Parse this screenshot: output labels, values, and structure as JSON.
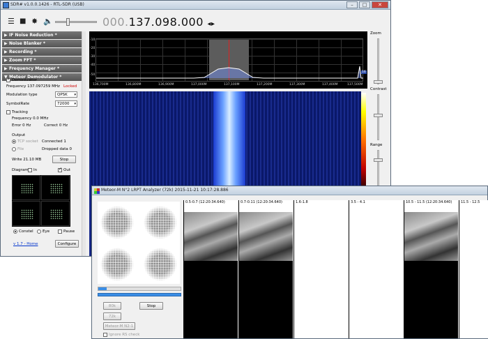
{
  "sdr": {
    "title": "SDR# v1.0.0.1426 - RTL-SDR (USB)",
    "frequency_dim": "000.",
    "frequency_main": "137.098.000",
    "freq_arrows": "◂▸",
    "panel": {
      "sections": [
        "IF Noise Reduction *",
        "Noise Blanker *",
        "Recording *",
        "Zoom FFT *",
        "Frequency Manager *",
        "Meteor Demodulator *"
      ],
      "demodulator_label": "Demodulator",
      "frequency_text": "Frequency 137.097259 MHz",
      "locked_text": "Locked",
      "modulation_label": "Modulation type",
      "modulation_value": "QPSK",
      "symbolrate_label": "SymbolRate",
      "symbolrate_value": "72000",
      "tracking_label": "Tracking",
      "freq_offset": "Frequency 0.0 MHz",
      "error_text": "Error 0 Hz",
      "correct_text": "Correct 0 Hz",
      "output_label": "Output",
      "tcp_label": "TCP socket",
      "connected_text": "Connected 1",
      "file_label": "File",
      "dropped_text": "Dropped data 0",
      "write_text": "Write 21.10 MB",
      "stop_label": "Stop",
      "diagram_label": "Diagram",
      "in_label": "In",
      "out_label": "Out",
      "constel_label": "Constel",
      "eye_label": "Eye",
      "pause_label": "Pause",
      "home_link": "v 1.7 - Home",
      "configure_label": "Configure"
    },
    "spectrum": {
      "y_labels": [
        "-10",
        "-20",
        "-30",
        "-40",
        "-50"
      ],
      "x_labels": [
        "136,700M",
        "136,800M",
        "136,900M",
        "137,000M",
        "137,100M",
        "137,200M",
        "137,300M",
        "137,400M",
        "137,500M"
      ],
      "marker": "16"
    },
    "side": {
      "zoom_label": "Zoom",
      "contrast_label": "Contrast",
      "range_label": "Range"
    }
  },
  "lrpt": {
    "title": "Meteor-M N°2 LRPT Analyzer (72k) 2015-11-21 10:17:28.886",
    "buttons": {
      "b80k": "80k",
      "stop": "Stop",
      "b72k": "72k",
      "meteor": "Meteor-M N2-1"
    },
    "ignore_rs": "Ignore RS check",
    "progress_fraction": 0.1,
    "channels": [
      {
        "label": "0.5-0.7 (12:20:34.640)",
        "has_image": true
      },
      {
        "label": "0.7-0.11 (12:20:34.640)",
        "has_image": true
      },
      {
        "label": "1.6-1.8",
        "has_image": false
      },
      {
        "label": "3.5 - 4.1",
        "has_image": false
      },
      {
        "label": "10.5 - 11.5 (12:20:34.640)",
        "has_image": true
      },
      {
        "label": "11.5 - 12.5",
        "has_image": false
      }
    ]
  },
  "colors": {
    "accent": "#3a8ee6",
    "locked": "#cc0000",
    "link": "#0033cc"
  }
}
